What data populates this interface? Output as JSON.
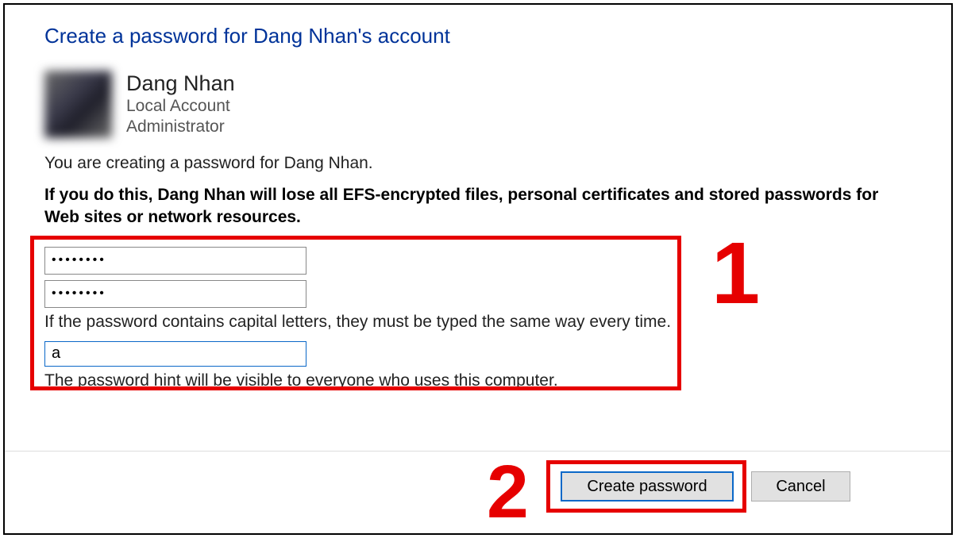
{
  "title": "Create a password for Dang Nhan's account",
  "user": {
    "name": "Dang Nhan",
    "type": "Local Account",
    "role": "Administrator"
  },
  "info_line": "You are creating a password for Dang Nhan.",
  "warning": "If you do this, Dang Nhan will lose all EFS-encrypted files, personal certificates and stored passwords for Web sites or network resources.",
  "fields": {
    "password_value": "••••••••",
    "confirm_value": "••••••••",
    "caps_caption": "If the password contains capital letters, they must be typed the same way every time.",
    "hint_value": "a",
    "hint_caption": "The password hint will be visible to everyone who uses this computer."
  },
  "buttons": {
    "create": "Create password",
    "cancel": "Cancel"
  },
  "annotations": {
    "one": "1",
    "two": "2"
  }
}
